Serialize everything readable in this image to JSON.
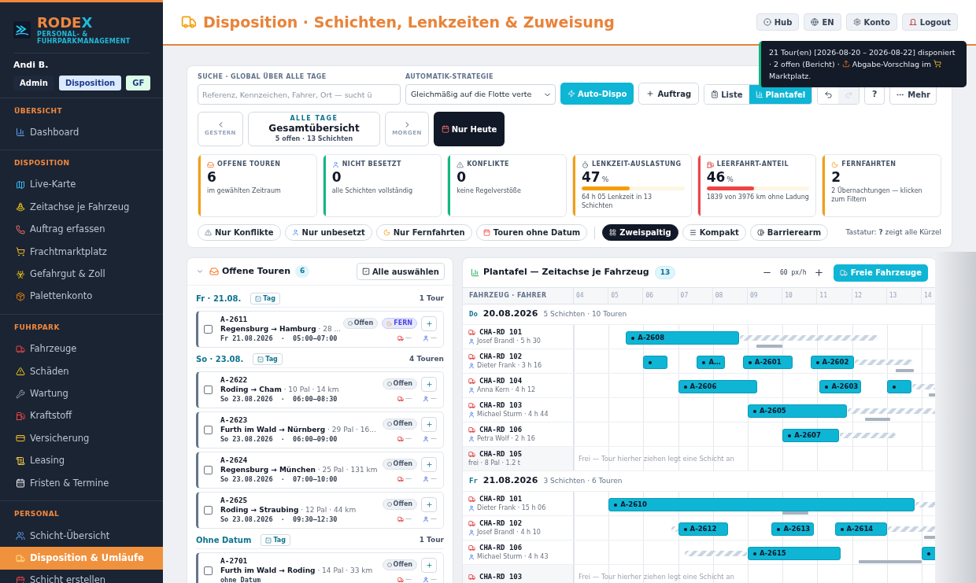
{
  "sidebar": {
    "brand": {
      "name_a": "RODE",
      "name_b": "X",
      "tagline": "PERSONAL- & FUHRPARKMANAGEMENT"
    },
    "user": {
      "name": "Andi B.",
      "roles": [
        {
          "label": "Admin",
          "color": "#1e293b"
        },
        {
          "label": "Disposition",
          "color": "#dbeafe"
        },
        {
          "label": "GF",
          "color": "#dcfce7"
        }
      ]
    },
    "sections": [
      {
        "title": "ÜBERSICHT",
        "items": [
          {
            "label": "Dashboard",
            "selected": false
          }
        ]
      },
      {
        "title": "DISPOSITION",
        "items": [
          {
            "label": "Live-Karte",
            "selected": false
          },
          {
            "label": "Zeitachse je Fahrzeug",
            "selected": false
          },
          {
            "label": "Auftrag erfassen",
            "selected": false
          },
          {
            "label": "Frachtmarktplatz",
            "selected": false
          },
          {
            "label": "Gefahrgut & Zoll",
            "selected": false
          },
          {
            "label": "Palettenkonto",
            "selected": false
          }
        ]
      },
      {
        "title": "FUHRPARK",
        "items": [
          {
            "label": "Fahrzeuge",
            "selected": false
          },
          {
            "label": "Schäden",
            "selected": false
          },
          {
            "label": "Wartung",
            "selected": false
          },
          {
            "label": "Kraftstoff",
            "selected": false
          },
          {
            "label": "Versicherung",
            "selected": false
          },
          {
            "label": "Leasing",
            "selected": false
          },
          {
            "label": "Fristen & Termine",
            "selected": false
          }
        ]
      },
      {
        "title": "PERSONAL",
        "items": [
          {
            "label": "Schicht-Übersicht",
            "selected": false
          },
          {
            "label": "Disposition & Umläufe",
            "selected": true
          },
          {
            "label": "Schicht erstellen",
            "selected": false
          }
        ]
      }
    ]
  },
  "header": {
    "title": "Disposition · Schichten, Lenkzeiten & Zuweisung",
    "buttons": [
      "Hub",
      "EN",
      "Konto",
      "Logout"
    ]
  },
  "toast": {
    "parts": [
      "21 Tour(en) [2026-08-20 – 2026-08-22] disponiert · 2 offen (Bericht) ·",
      "Abgabe-Vorschlag im",
      "Marktplatz."
    ]
  },
  "toolbar": {
    "search": {
      "label": "SUCHE · GLOBAL ÜBER ALLE TAGE",
      "placeholder": "Referenz, Kennzeichen, Fahrer, Ort — sucht ü"
    },
    "strategy": {
      "label": "AUTOMATIK-STRATEGIE",
      "value": "Gleichmäßig auf die Flotte verte"
    },
    "auto_button": "Auto-Dispo",
    "order_button": "Auftrag",
    "views": [
      {
        "label": "Liste",
        "selected": false
      },
      {
        "label": "Plantafel",
        "selected": true
      }
    ],
    "history": [
      {
        "kind": "undo",
        "disabled": false
      },
      {
        "kind": "redo",
        "disabled": true
      }
    ],
    "help_button": "?",
    "more_button": "Mehr"
  },
  "day_nav": {
    "prev": "GESTERN",
    "kicker": "ALLE TAGE",
    "title": "Gesamtübersicht",
    "summary": "5 offen · 13 Schichten",
    "next": "MORGEN",
    "today": "Nur Heute"
  },
  "kpis": [
    {
      "label": "OFFENE TOUREN",
      "value": "6",
      "note": "im gewählten Zeitraum",
      "color": "#f59e0b"
    },
    {
      "label": "NICHT BESETZT",
      "value": "0",
      "note": "alle Schichten vollständig",
      "color": "#10b981"
    },
    {
      "label": "KONFLIKTE",
      "value": "0",
      "note": "keine Regelverstöße",
      "color": "#10b981"
    },
    {
      "label": "LENKZEIT-AUSLASTUNG",
      "value": "47",
      "unit": "%",
      "level": 0.47,
      "note": "64 h 05 Lenkzeit in 13 Schichten",
      "color": "#f59e0b"
    },
    {
      "label": "LEERFAHRT-ANTEIL",
      "value": "46",
      "unit": "%",
      "level": 0.46,
      "note": "1839 von 3976 km ohne Ladung",
      "color": "#ef4444"
    },
    {
      "label": "FERNFAHRTEN",
      "value": "2",
      "note": "2 Übernachtungen — klicken zum Filtern",
      "color": "#f59e0b"
    }
  ],
  "filters": [
    {
      "label": "Nur Konflikte",
      "selected": false
    },
    {
      "label": "Nur unbesetzt",
      "selected": false
    },
    {
      "label": "Nur Fernfahrten",
      "selected": false
    },
    {
      "label": "Touren ohne Datum",
      "selected": false
    }
  ],
  "layouts": [
    {
      "label": "Zweispaltig",
      "selected": true
    },
    {
      "label": "Kompakt",
      "selected": false
    },
    {
      "label": "Barrierearm",
      "selected": false
    }
  ],
  "shortcut_hint": "Tastatur: **?** zeigt alle Kürzel",
  "open_tours": {
    "title": "Offene Touren",
    "count": "6",
    "expanded": true,
    "select_all": "Alle auswählen",
    "groups": [
      {
        "date": "Fr · 21.08.",
        "tag": "Tag",
        "count": "1 Tour",
        "tours": [
          {
            "id": "A-2611",
            "route": "Regensburg → Hamburg",
            "meta": "· 28 ...",
            "when": "Fr 21.08.2026  ·  05:00–07:00",
            "status": "Offen",
            "fern": "FERN",
            "vehicle": "—",
            "driver": "—",
            "checked": false
          }
        ]
      },
      {
        "date": "So · 23.08.",
        "tag": "Tag",
        "count": "4 Touren",
        "tours": [
          {
            "id": "A-2622",
            "route": "Roding → Cham",
            "meta": "· 10 Pal · 14 km",
            "when": "So 23.08.2026  ·  06:00–08:30",
            "status": "Offen",
            "vehicle": "—",
            "driver": "—",
            "checked": false
          },
          {
            "id": "A-2623",
            "route": "Furth im Wald → Nürnberg",
            "meta": "· 29 Pal · 16...",
            "when": "So 23.08.2026  ·  06:00–09:00",
            "status": "Offen",
            "vehicle": "—",
            "driver": "—",
            "checked": false
          },
          {
            "id": "A-2624",
            "route": "Regensburg → München",
            "meta": "· 25 Pal · 131 km",
            "when": "So 23.08.2026  ·  07:00–10:00",
            "status": "Offen",
            "vehicle": "—",
            "driver": "—",
            "checked": false
          },
          {
            "id": "A-2625",
            "route": "Roding → Straubing",
            "meta": "· 12 Pal · 44 km",
            "when": "So 23.08.2026  ·  09:30–12:30",
            "status": "Offen",
            "vehicle": "—",
            "driver": "—",
            "checked": false
          }
        ]
      },
      {
        "date": "Ohne Datum",
        "tag": "Tag",
        "count": "1 Tour",
        "tours": [
          {
            "id": "A-2701",
            "route": "Furth im Wald → Roding",
            "meta": "· 14 Pal · 33 km",
            "when": "ohne Datum",
            "status": "Offen",
            "vehicle": "—",
            "driver": "—",
            "checked": false
          }
        ]
      }
    ]
  },
  "plantafel": {
    "title": "Plantafel — Zeitachse je Fahrzeug",
    "count": "13",
    "zoom": "60 px/h",
    "free_button": "Freie Fahrzeuge",
    "column_head": "FAHRZEUG · FAHRER",
    "hours": [
      "04",
      "05",
      "06",
      "07",
      "08",
      "09",
      "10",
      "11",
      "12",
      "13",
      "14"
    ],
    "days": [
      {
        "dow": "Do",
        "date": "20.08.2026",
        "summary": "5 Schichten · 10 Touren",
        "rows": [
          {
            "kind": "shift",
            "plate": "CHA-RD 101",
            "driver": "Josef Brandl · 5 h 30",
            "items": [
              {
                "kind": "tour",
                "label": "A-2608"
              },
              {
                "kind": "rest"
              },
              {
                "kind": "break"
              }
            ]
          },
          {
            "kind": "shift",
            "plate": "CHA-RD 102",
            "driver": "Dieter Frank · 3 h 16",
            "items": [
              {
                "kind": "tour"
              },
              {
                "kind": "tour",
                "label": "A…"
              },
              {
                "kind": "tour",
                "label": "A-2601"
              },
              {
                "kind": "tour",
                "label": "A-2602"
              },
              {
                "kind": "rest"
              },
              {
                "kind": "break"
              }
            ]
          },
          {
            "kind": "shift",
            "plate": "CHA-RD 104",
            "driver": "Anna Kern · 4 h 12",
            "items": [
              {
                "kind": "tour",
                "label": "A-2606"
              },
              {
                "kind": "tour",
                "label": "A-2603"
              },
              {
                "kind": "tour"
              },
              {
                "kind": "rest"
              },
              {
                "kind": "break"
              }
            ]
          },
          {
            "kind": "shift",
            "plate": "CHA-RD 103",
            "driver": "Michael Sturm · 4 h 44",
            "items": [
              {
                "kind": "tour",
                "label": "A-2605"
              },
              {
                "kind": "rest"
              },
              {
                "kind": "break"
              }
            ]
          },
          {
            "kind": "shift",
            "plate": "CHA-RD 106",
            "driver": "Petra Wolf · 2 h 16",
            "items": [
              {
                "kind": "tour",
                "label": "A-2607"
              },
              {
                "kind": "rest"
              }
            ]
          },
          {
            "kind": "free",
            "plate": "CHA-RD 105",
            "driver": "frei · 8 Pal · 1.2 t",
            "free_text": "Frei — Tour hierher ziehen legt eine Schicht an"
          }
        ]
      },
      {
        "dow": "Fr",
        "date": "21.08.2026",
        "summary": "3 Schichten · 6 Touren",
        "rows": [
          {
            "kind": "shift",
            "plate": "CHA-RD 101",
            "driver": "Dieter Frank · 15 h 06",
            "items": [
              {
                "kind": "tour",
                "label": "A-2610"
              },
              {
                "kind": "rest"
              },
              {
                "kind": "break"
              }
            ]
          },
          {
            "kind": "shift",
            "plate": "CHA-RD 102",
            "driver": "Josef Brandl · 4 h 10",
            "items": [
              {
                "kind": "rest"
              },
              {
                "kind": "tour",
                "label": "A-2612"
              },
              {
                "kind": "tour",
                "label": "A-2613"
              },
              {
                "kind": "tour",
                "label": "A-2614"
              },
              {
                "kind": "rest"
              },
              {
                "kind": "break"
              }
            ]
          },
          {
            "kind": "shift",
            "plate": "CHA-RD 106",
            "driver": "Michael Sturm · 4 h 43",
            "items": [
              {
                "kind": "rest"
              },
              {
                "kind": "tour",
                "label": "A-2615"
              },
              {
                "kind": "tour"
              },
              {
                "kind": "break"
              }
            ]
          },
          {
            "kind": "free",
            "plate": "CHA-RD 103",
            "free_text": "Frei — Tour hierher ziehen legt eine Schicht an"
          }
        ]
      }
    ]
  }
}
